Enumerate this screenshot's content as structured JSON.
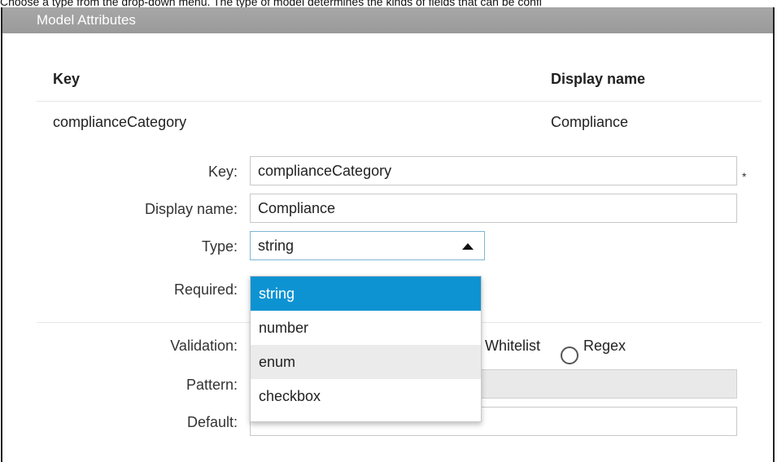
{
  "caption": "Choose a type from the drop-down menu. The type of model determines the kinds of fields that can be confi",
  "panel": {
    "title": "Model Attributes"
  },
  "table": {
    "headers": {
      "key": "Key",
      "display_name": "Display name"
    },
    "row": {
      "key": "complianceCategory",
      "display_name": "Compliance"
    }
  },
  "form": {
    "key_label": "Key:",
    "key_value": "complianceCategory",
    "required_marker": "*",
    "display_label": "Display name:",
    "display_value": "Compliance",
    "type_label": "Type:",
    "type_value": "string",
    "required_label": "Required:",
    "validation_label": "Validation:",
    "validation_options": [
      "Whitelist",
      "Regex"
    ],
    "pattern_label": "Pattern:",
    "pattern_value": "",
    "default_label": "Default:",
    "default_value": ""
  },
  "dropdown": {
    "options": [
      "string",
      "number",
      "enum",
      "checkbox"
    ],
    "selected": "string",
    "hovered": "enum"
  },
  "colors": {
    "header_bg": "#a0a0a0",
    "selected_bg": "#0d93d2",
    "hover_bg": "#ebebeb",
    "disabled_bg": "#e9e9e9"
  },
  "icons": {
    "select_caret": "caret-up-icon",
    "radio": "radio-unchecked-icon"
  }
}
